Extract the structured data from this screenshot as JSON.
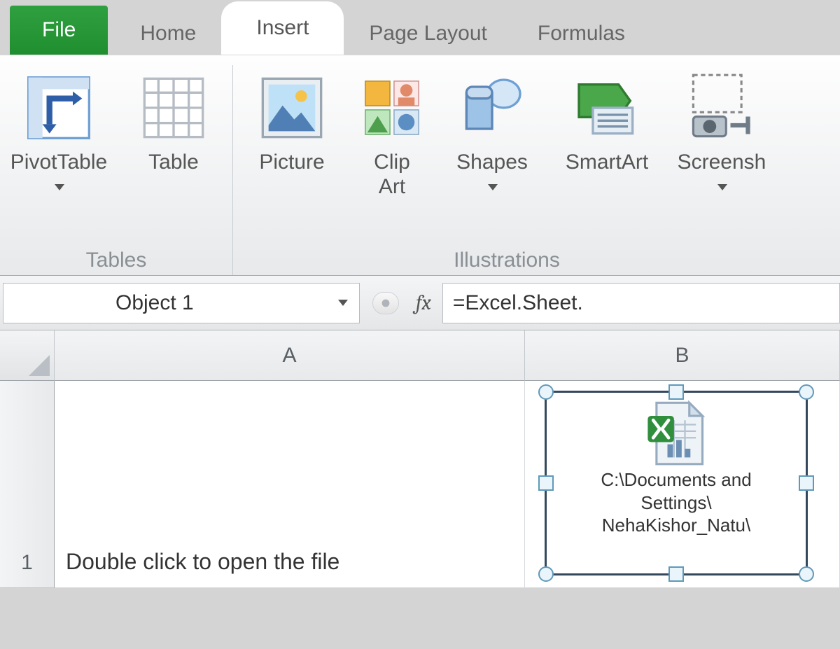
{
  "tabs": {
    "file": "File",
    "home": "Home",
    "insert": "Insert",
    "pageLayout": "Page Layout",
    "formulas": "Formulas"
  },
  "ribbon": {
    "groups": {
      "tables": {
        "label": "Tables",
        "pivotTable": "PivotTable",
        "table": "Table"
      },
      "illustrations": {
        "label": "Illustrations",
        "picture": "Picture",
        "clipArt": "Clip\nArt",
        "shapes": "Shapes",
        "smartArt": "SmartArt",
        "screenshot": "Screensh"
      }
    }
  },
  "formulaBar": {
    "nameBox": "Object 1",
    "fxLabel": "fx",
    "formula": "=Excel.Sheet."
  },
  "columns": {
    "A": "A",
    "B": "B"
  },
  "rows": {
    "r1": "1"
  },
  "cells": {
    "A1": "Double click to open the file"
  },
  "embeddedObject": {
    "line1": "C:\\Documents and",
    "line2": "Settings\\",
    "line3": "NehaKishor_Natu\\"
  }
}
